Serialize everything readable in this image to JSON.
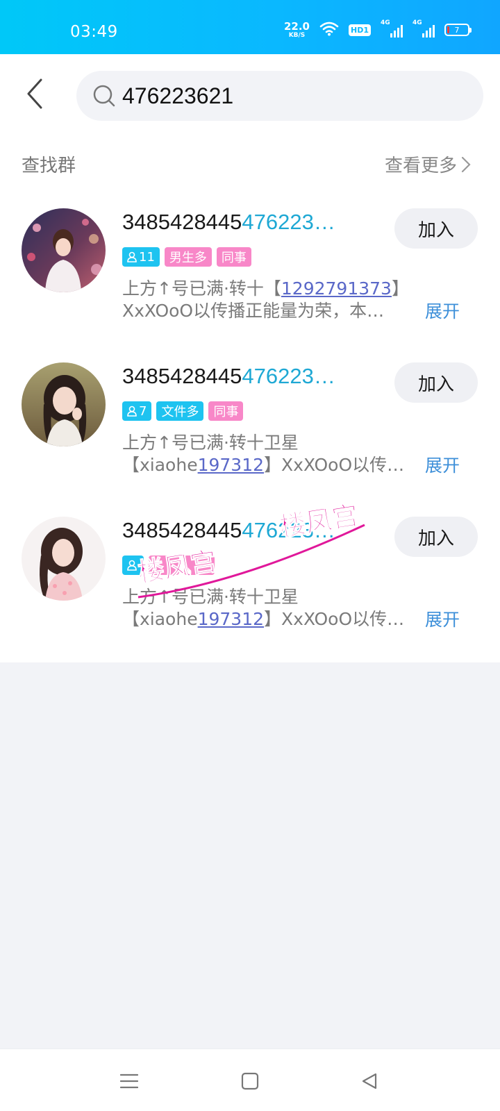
{
  "status_bar": {
    "time": "03:49",
    "net_speed_value": "22.0",
    "net_speed_unit": "KB/S",
    "hd_label": "HD1",
    "sim1_label": "4G",
    "sim2_label": "4G",
    "battery_level": "7"
  },
  "header": {
    "search_value": "476223621"
  },
  "section": {
    "title": "查找群",
    "more_label": "查看更多"
  },
  "groups": [
    {
      "title_prefix": "3485428445",
      "title_highlight": "476223…",
      "member_count": "11",
      "tags": [
        "男生多",
        "同事"
      ],
      "desc_line1_prefix": "上方↑号已满·转十【",
      "desc_line1_link": "1292791373",
      "desc_line1_suffix": "】",
      "desc_line2_prefix": "XxXOoO以传播正能量为荣，本…",
      "desc_line2_link": "",
      "desc_line2_suffix": "",
      "expand_label": "展开",
      "join_label": "加入"
    },
    {
      "title_prefix": "3485428445",
      "title_highlight": "476223…",
      "member_count": "7",
      "tags": [
        "文件多",
        "同事"
      ],
      "desc_line1_prefix": "上方↑号已满·转十卫星",
      "desc_line1_link": "",
      "desc_line1_suffix": "",
      "desc_line2_prefix": "【xiaohe",
      "desc_line2_link": "197312",
      "desc_line2_suffix": "】XxXOoO以传…",
      "expand_label": "展开",
      "join_label": "加入"
    },
    {
      "title_prefix": "3485428445",
      "title_highlight": "476223…",
      "member_count": "",
      "tags": [],
      "desc_line1_prefix": "上方↑号已满·转十卫星",
      "desc_line1_link": "",
      "desc_line1_suffix": "",
      "desc_line2_prefix": "【xiaohe",
      "desc_line2_link": "197312",
      "desc_line2_suffix": "】XxXOoO以传…",
      "expand_label": "展开",
      "join_label": "加入"
    }
  ],
  "watermark_text": "楼凤宫",
  "colors": {
    "status_bar_start": "#00c8f8",
    "status_bar_end": "#10a6ff",
    "highlight": "#1ea8d4",
    "tag_blue": "#1ec3f0",
    "tag_pink": "#f887c8",
    "link": "#5a68c8",
    "expand": "#3d8fd9",
    "watermark": "#e0189a"
  }
}
